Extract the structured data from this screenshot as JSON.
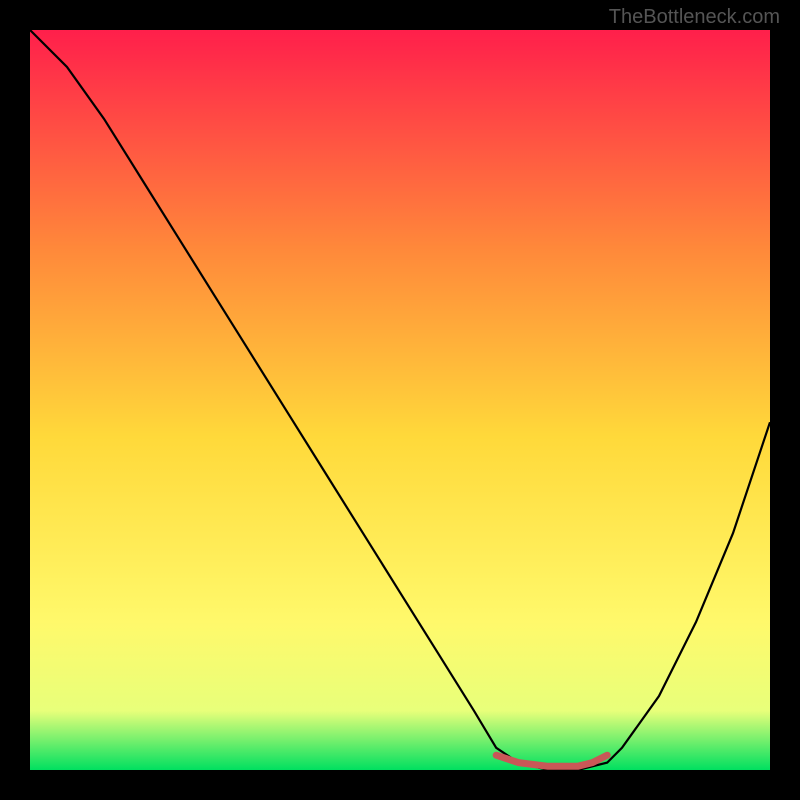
{
  "watermark": "TheBottleneck.com",
  "chart_data": {
    "type": "line",
    "title": "",
    "xlabel": "",
    "ylabel": "",
    "xlim": [
      0,
      100
    ],
    "ylim": [
      0,
      100
    ],
    "series": [
      {
        "name": "curve",
        "color": "#000000",
        "x": [
          0,
          5,
          10,
          15,
          20,
          25,
          30,
          35,
          40,
          45,
          50,
          55,
          60,
          63,
          66,
          70,
          74,
          78,
          80,
          85,
          90,
          95,
          100
        ],
        "y": [
          100,
          95,
          88,
          80,
          72,
          64,
          56,
          48,
          40,
          32,
          24,
          16,
          8,
          3,
          1,
          0,
          0,
          1,
          3,
          10,
          20,
          32,
          47
        ]
      },
      {
        "name": "flat-highlight",
        "color": "#c95757",
        "x": [
          63,
          66,
          70,
          74,
          76,
          78
        ],
        "y": [
          2,
          1,
          0.5,
          0.5,
          1,
          2
        ]
      }
    ],
    "gradient_background": {
      "top": "#ff1f4b",
      "mid_upper": "#ff8a3a",
      "mid": "#ffd93a",
      "mid_lower": "#fff96b",
      "band": "#e8ff7a",
      "bottom": "#00e060"
    }
  }
}
